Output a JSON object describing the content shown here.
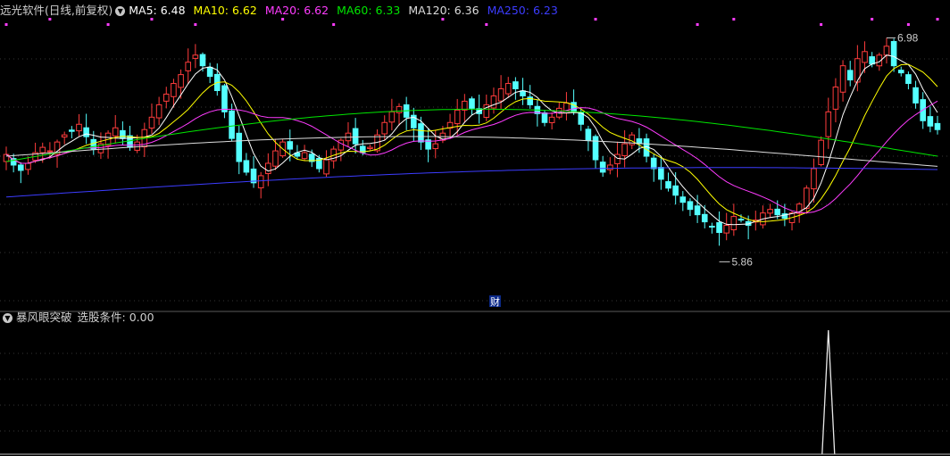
{
  "header": {
    "stock_label": "远光软件(日线,前复权)",
    "dropdown_icon": "chevron-down-icon",
    "ma": [
      {
        "label": "MA5: 6.48",
        "color": "#ffffff"
      },
      {
        "label": "MA10: 6.62",
        "color": "#ffff00"
      },
      {
        "label": "MA20: 6.62",
        "color": "#ff3cff"
      },
      {
        "label": "MA60: 6.33",
        "color": "#00e600"
      },
      {
        "label": "MA120: 6.36",
        "color": "#dcdcdc"
      },
      {
        "label": "MA250: 6.23",
        "color": "#3c3cff"
      }
    ]
  },
  "indicator": {
    "name": "暴风眼突破",
    "condition": "选股条件: 0.00"
  },
  "chart_data": {
    "type": "candlestick",
    "ylim": [
      5.5,
      7.1
    ],
    "up_color": "#ff3c3c",
    "down_color": "#54ffff",
    "annotations": {
      "high": "6.98",
      "low": "5.86",
      "marker": "财"
    },
    "closes": [
      6.34,
      6.28,
      6.25,
      6.29,
      6.35,
      6.38,
      6.36,
      6.41,
      6.45,
      6.47,
      6.51,
      6.44,
      6.37,
      6.4,
      6.46,
      6.49,
      6.43,
      6.38,
      6.41,
      6.48,
      6.55,
      6.62,
      6.68,
      6.74,
      6.79,
      6.86,
      6.9,
      6.84,
      6.78,
      6.7,
      6.58,
      6.43,
      6.3,
      6.24,
      6.18,
      6.22,
      6.29,
      6.36,
      6.41,
      6.37,
      6.33,
      6.35,
      6.3,
      6.26,
      6.31,
      6.37,
      6.42,
      6.46,
      6.4,
      6.35,
      6.38,
      6.45,
      6.52,
      6.58,
      6.61,
      6.55,
      6.49,
      6.41,
      6.37,
      6.4,
      6.46,
      6.52,
      6.59,
      6.64,
      6.6,
      6.57,
      6.62,
      6.67,
      6.71,
      6.74,
      6.71,
      6.67,
      6.62,
      6.57,
      6.52,
      6.55,
      6.6,
      6.63,
      6.58,
      6.51,
      6.42,
      6.31,
      6.24,
      6.28,
      6.34,
      6.4,
      6.45,
      6.4,
      6.33,
      6.26,
      6.2,
      6.15,
      6.11,
      6.07,
      6.03,
      6.0,
      5.96,
      5.93,
      5.9,
      5.94,
      5.99,
      5.97,
      5.94,
      5.97,
      6.01,
      6.03,
      6.0,
      5.98,
      6.01,
      6.06,
      6.15,
      6.26,
      6.42,
      6.58,
      6.72,
      6.84,
      6.76,
      6.88,
      6.92,
      6.85,
      6.9,
      6.95,
      6.84,
      6.8,
      6.74,
      6.63,
      6.53,
      6.5,
      6.48
    ],
    "ma_series": [
      {
        "name": "MA5",
        "values": [
          6.24,
          6.3
        ]
      },
      {
        "name": "MA10",
        "values": [
          6.2,
          6.25
        ]
      },
      {
        "name": "MA20",
        "values": [
          6.18,
          6.2
        ]
      },
      {
        "name": "MA60",
        "values": [
          6.3,
          6.33
        ]
      },
      {
        "name": "MA120",
        "values": [
          6.38,
          6.36
        ]
      },
      {
        "name": "MA250",
        "values": [
          6.1,
          6.23
        ]
      }
    ],
    "signal": {
      "type": "spike",
      "peak_value": 1,
      "at_index": 113
    }
  }
}
